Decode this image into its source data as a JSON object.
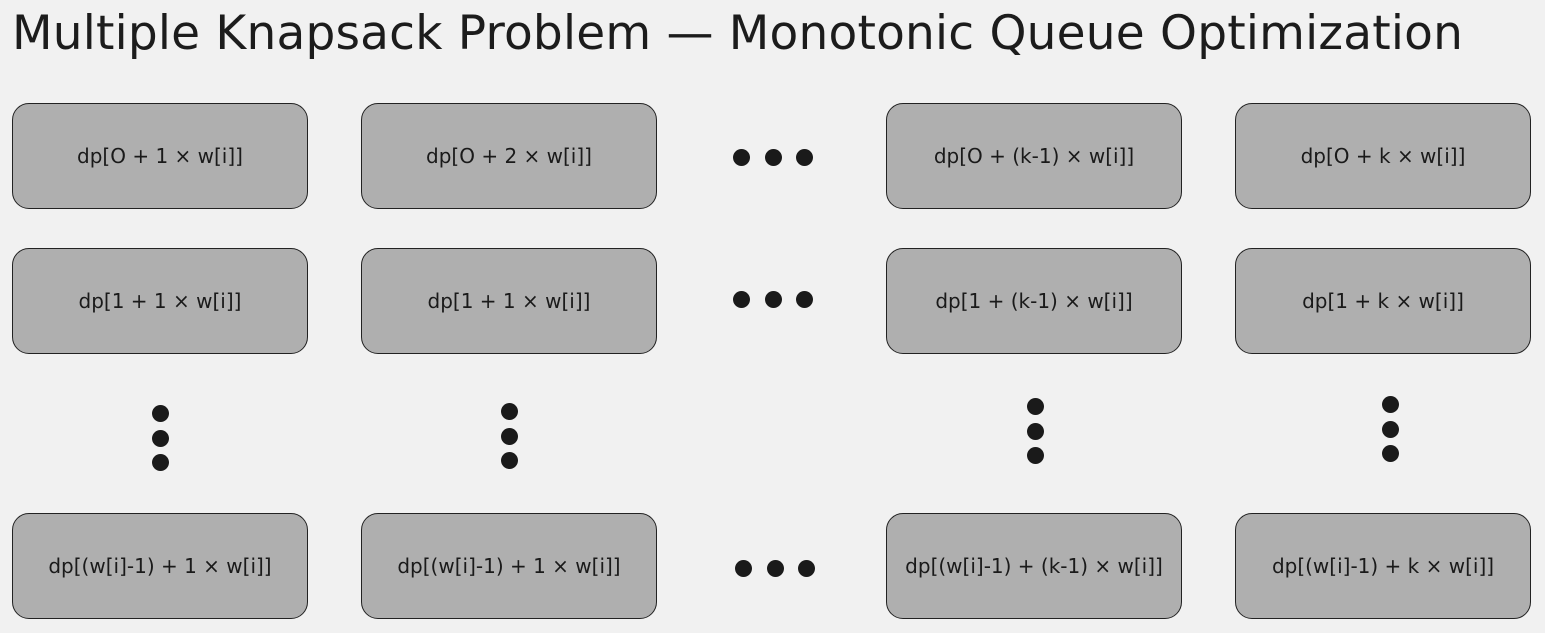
{
  "title": "Multiple Knapsack Problem — Monotonic Queue Optimization",
  "rows": [
    [
      "dp[O + 1 × w[i]]",
      "dp[O + 2 × w[i]]",
      "dp[O + (k-1) × w[i]]",
      "dp[O + k × w[i]]"
    ],
    [
      "dp[1 + 1 × w[i]]",
      "dp[1 + 1 × w[i]]",
      "dp[1 + (k-1) × w[i]]",
      "dp[1 + k × w[i]]"
    ],
    [
      "dp[(w[i]-1) + 1 × w[i]]",
      "dp[(w[i]-1) + 1 × w[i]]",
      "dp[(w[i]-1) + (k-1) × w[i]]",
      "dp[(w[i]-1) + k × w[i]]"
    ]
  ]
}
